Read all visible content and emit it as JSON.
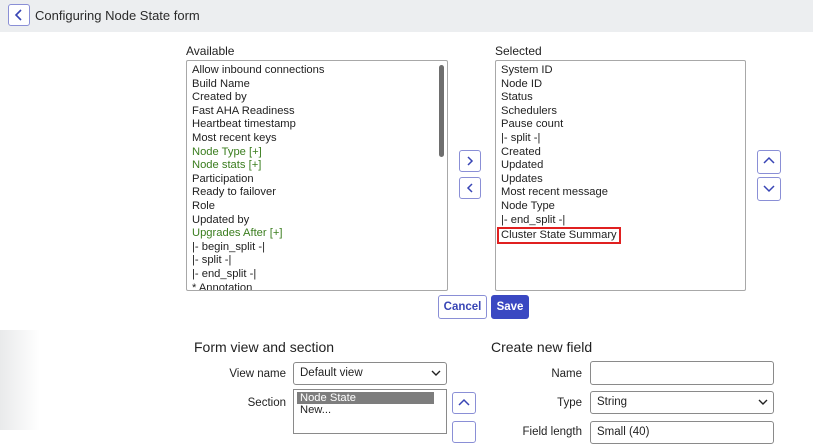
{
  "header": {
    "title": "Configuring Node State form"
  },
  "available": {
    "heading": "Available",
    "items": [
      {
        "label": "Allow inbound connections",
        "green": false
      },
      {
        "label": "Build Name",
        "green": false
      },
      {
        "label": "Created by",
        "green": false
      },
      {
        "label": "Fast AHA Readiness",
        "green": false
      },
      {
        "label": "Heartbeat timestamp",
        "green": false
      },
      {
        "label": "Most recent keys",
        "green": false
      },
      {
        "label": "Node Type [+]",
        "green": true
      },
      {
        "label": "Node stats [+]",
        "green": true
      },
      {
        "label": "Participation",
        "green": false
      },
      {
        "label": "Ready to failover",
        "green": false
      },
      {
        "label": "Role",
        "green": false
      },
      {
        "label": "Updated by",
        "green": false
      },
      {
        "label": "Upgrades After [+]",
        "green": true
      },
      {
        "label": "|- begin_split -|",
        "green": false
      },
      {
        "label": "|- split -|",
        "green": false
      },
      {
        "label": "|- end_split -|",
        "green": false
      },
      {
        "label": "* Annotation",
        "green": false
      }
    ]
  },
  "selected": {
    "heading": "Selected",
    "items": [
      "System ID",
      "Node ID",
      "Status",
      "Schedulers",
      "Pause count",
      "|- split -|",
      "Created",
      "Updated",
      "Updates",
      "Most recent message",
      "Node Type",
      "|- end_split -|"
    ],
    "highlighted_item": "Cluster State Summary"
  },
  "buttons": {
    "cancel": "Cancel",
    "save": "Save"
  },
  "form_view": {
    "heading": "Form view and section",
    "view_name_label": "View name",
    "view_name_value": "Default view",
    "section_label": "Section",
    "sections": [
      {
        "label": "Node State",
        "selected": true
      },
      {
        "label": "New...",
        "selected": false
      }
    ]
  },
  "create_field": {
    "heading": "Create new field",
    "name_label": "Name",
    "name_value": "",
    "type_label": "Type",
    "type_value": "String",
    "field_length_label": "Field length",
    "field_length_value": "Small (40)"
  },
  "colors": {
    "accent": "#3a48c2",
    "highlight_border": "#e02020",
    "reference_green": "#3a7d1e"
  }
}
